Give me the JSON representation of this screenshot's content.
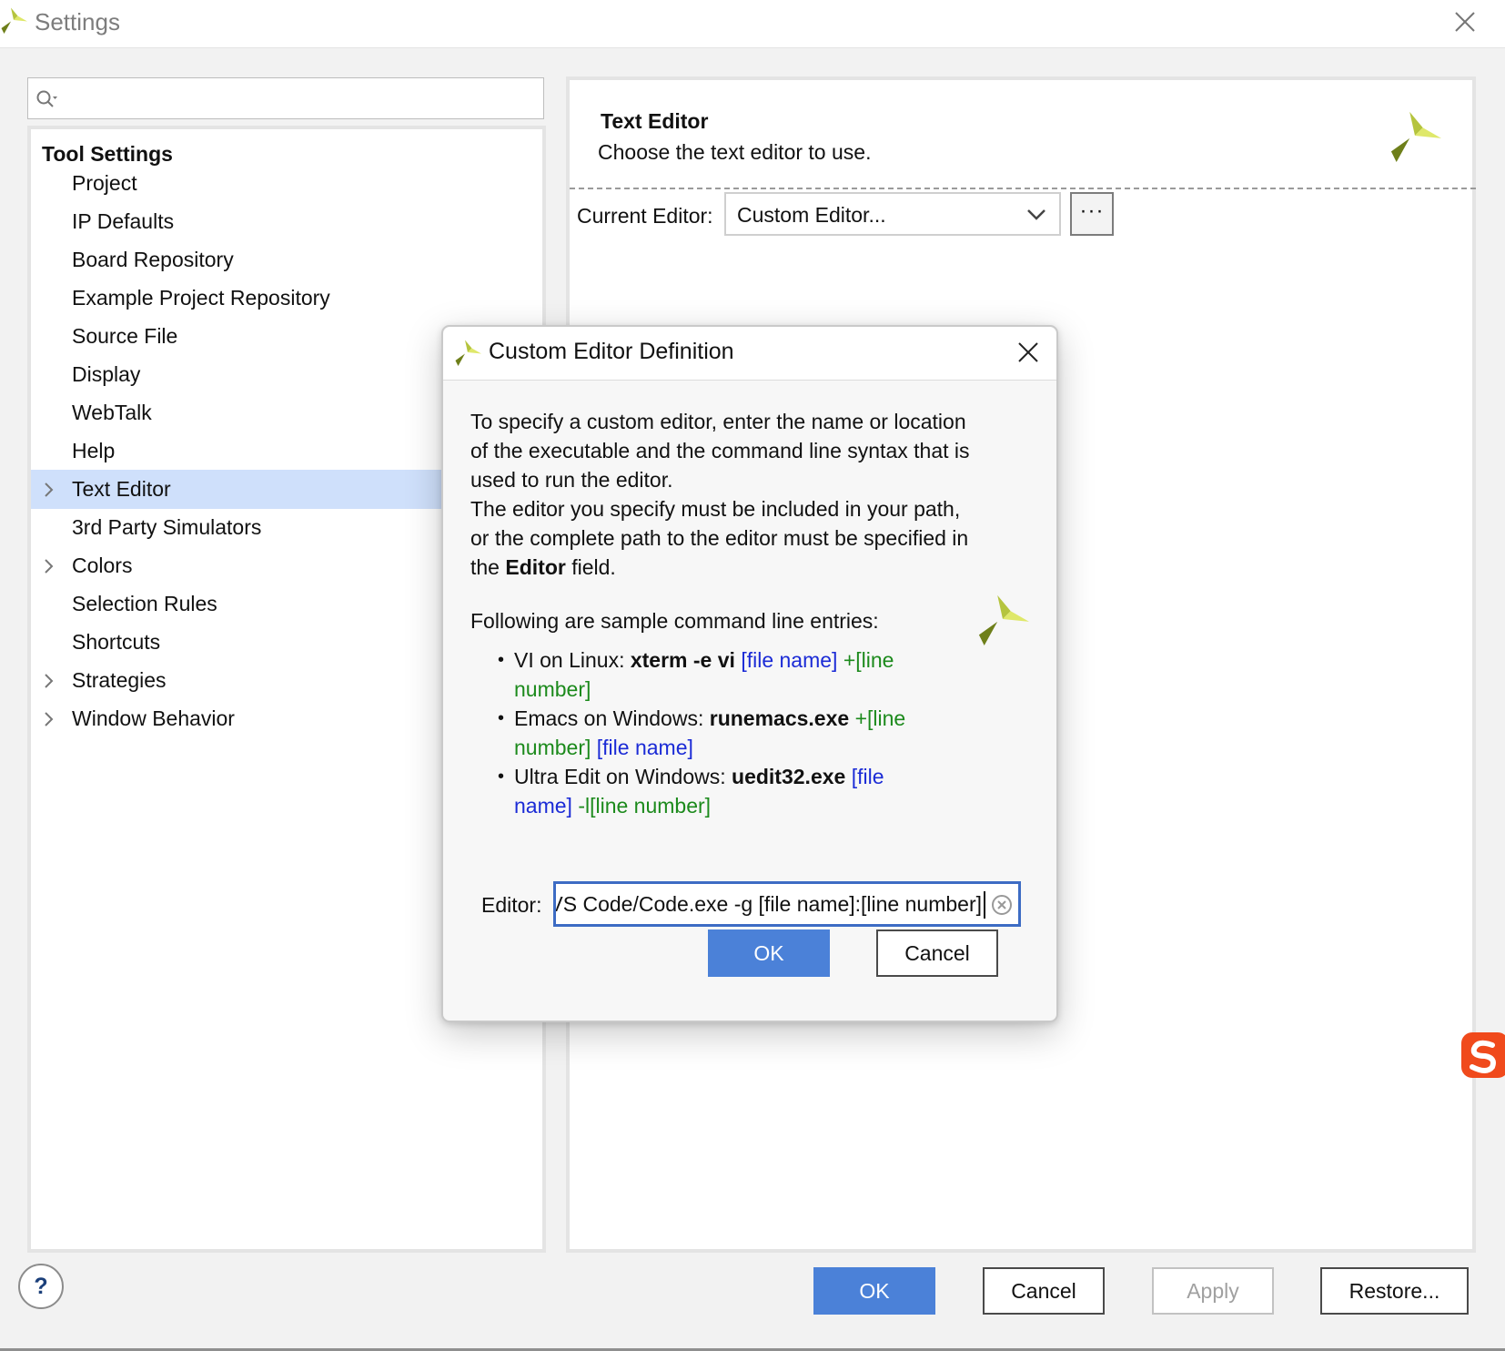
{
  "window": {
    "title": "Settings",
    "close_icon": "close-icon"
  },
  "search": {
    "value": "",
    "placeholder": "",
    "icon": "search-icon"
  },
  "tree": {
    "root_label": "Tool Settings",
    "items": [
      {
        "label": "Project",
        "expandable": false,
        "selected": false
      },
      {
        "label": "IP Defaults",
        "expandable": false,
        "selected": false
      },
      {
        "label": "Board Repository",
        "expandable": false,
        "selected": false
      },
      {
        "label": "Example Project Repository",
        "expandable": false,
        "selected": false
      },
      {
        "label": "Source File",
        "expandable": false,
        "selected": false
      },
      {
        "label": "Display",
        "expandable": false,
        "selected": false
      },
      {
        "label": "WebTalk",
        "expandable": false,
        "selected": false
      },
      {
        "label": "Help",
        "expandable": false,
        "selected": false
      },
      {
        "label": "Text Editor",
        "expandable": true,
        "selected": true
      },
      {
        "label": "3rd Party Simulators",
        "expandable": false,
        "selected": false
      },
      {
        "label": "Colors",
        "expandable": true,
        "selected": false
      },
      {
        "label": "Selection Rules",
        "expandable": false,
        "selected": false
      },
      {
        "label": "Shortcuts",
        "expandable": false,
        "selected": false
      },
      {
        "label": "Strategies",
        "expandable": true,
        "selected": false
      },
      {
        "label": "Window Behavior",
        "expandable": true,
        "selected": false
      }
    ]
  },
  "content": {
    "title": "Text Editor",
    "description": "Choose the text editor to use.",
    "current_editor_label": "Current Editor:",
    "current_editor_value": "Custom Editor...",
    "browse_label": "···"
  },
  "footer": {
    "help_label": "?",
    "ok_label": "OK",
    "cancel_label": "Cancel",
    "apply_label": "Apply",
    "restore_label": "Restore..."
  },
  "dialog": {
    "title": "Custom Editor Definition",
    "intro_1": "To specify a custom editor, enter the name or location of the executable and the command line syntax that is used to run the editor.",
    "intro_2_pre": "The editor you specify must be included in your path, or the complete path to the editor must be specified in the ",
    "intro_2_bold": "Editor",
    "intro_2_post": " field.",
    "following": "Following are sample command line entries:",
    "bullet_1": {
      "pre": "VI on Linux: ",
      "cmd": "xterm -e vi",
      "blue": "[file name]",
      "green": "+[line number]"
    },
    "bullet_2": {
      "pre": "Emacs on Windows: ",
      "cmd": "runemacs.exe",
      "green": "+[line number]",
      "blue": "[file name]"
    },
    "bullet_3": {
      "pre": "Ultra Edit on Windows: ",
      "cmd": "uedit32.exe",
      "blue": "[file name]",
      "green": "-l[line number]"
    },
    "editor_label": "Editor:",
    "editor_value": "Microsoft VS Code/Code.exe -g [file name]:[line number]",
    "ok_label": "OK",
    "cancel_label": "Cancel"
  },
  "colors": {
    "accent": "#4b81d8",
    "selection": "#cfe0fb",
    "link_blue": "#1b2bd6",
    "link_green": "#1c8a1c"
  }
}
